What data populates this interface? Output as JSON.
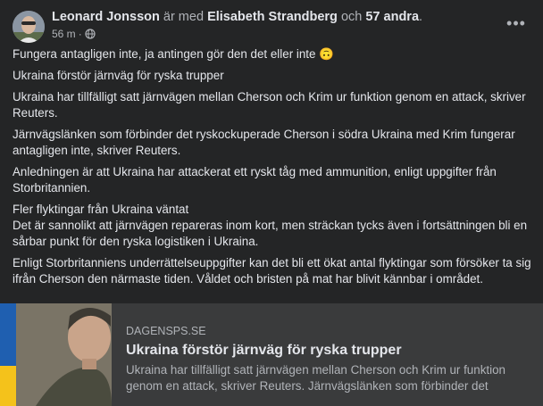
{
  "post": {
    "author": "Leonard Jonsson",
    "with_text": "är med",
    "tagged": "Elisabeth Strandberg",
    "and_text": "och",
    "others": "57 andra",
    "period": ".",
    "time": "56 m",
    "dot": "·",
    "paragraphs": [
      "Fungera antagligen inte, ja antingen gör den det eller inte 🙃",
      "Ukraina förstör järnväg för ryska trupper",
      "Ukraina har tillfälligt satt järnvägen mellan Cherson och Krim ur funktion genom en attack, skriver Reuters.",
      "Järnvägslänken som förbinder det ryskockuperade Cherson i södra Ukraina med Krim fungerar antagligen inte, skriver Reuters.",
      "Anledningen är att Ukraina har attackerat ett ryskt tåg med ammunition, enligt uppgifter från Storbritannien.",
      "Fler flyktingar från Ukraina väntat",
      "Det är sannolikt att järnvägen repareras inom kort, men sträckan tycks även i fortsättningen bli en sårbar punkt för den ryska logistiken i Ukraina.",
      "Enligt Storbritanniens underrättelseuppgifter kan det bli ett ökat antal flyktingar som försöker ta sig ifrån Cherson den närmaste tiden. Våldet och bristen på mat har blivit kännbar i området."
    ]
  },
  "link": {
    "domain": "DAGENSPS.SE",
    "title": "Ukraina förstör järnväg för ryska trupper",
    "description": "Ukraina har tillfälligt satt järnvägen mellan Cherson och Krim ur funktion genom en attack, skriver Reuters. Järnvägslänken som förbinder det"
  },
  "icons": {
    "more": "more-horizontal-icon",
    "audience": "globe-icon"
  },
  "colors": {
    "background": "#242526",
    "card": "#3a3b3c",
    "text": "#e4e6eb",
    "secondary": "#b0b3b8",
    "flag_blue": "#1f5fb0",
    "flag_yellow": "#f4c21b"
  }
}
